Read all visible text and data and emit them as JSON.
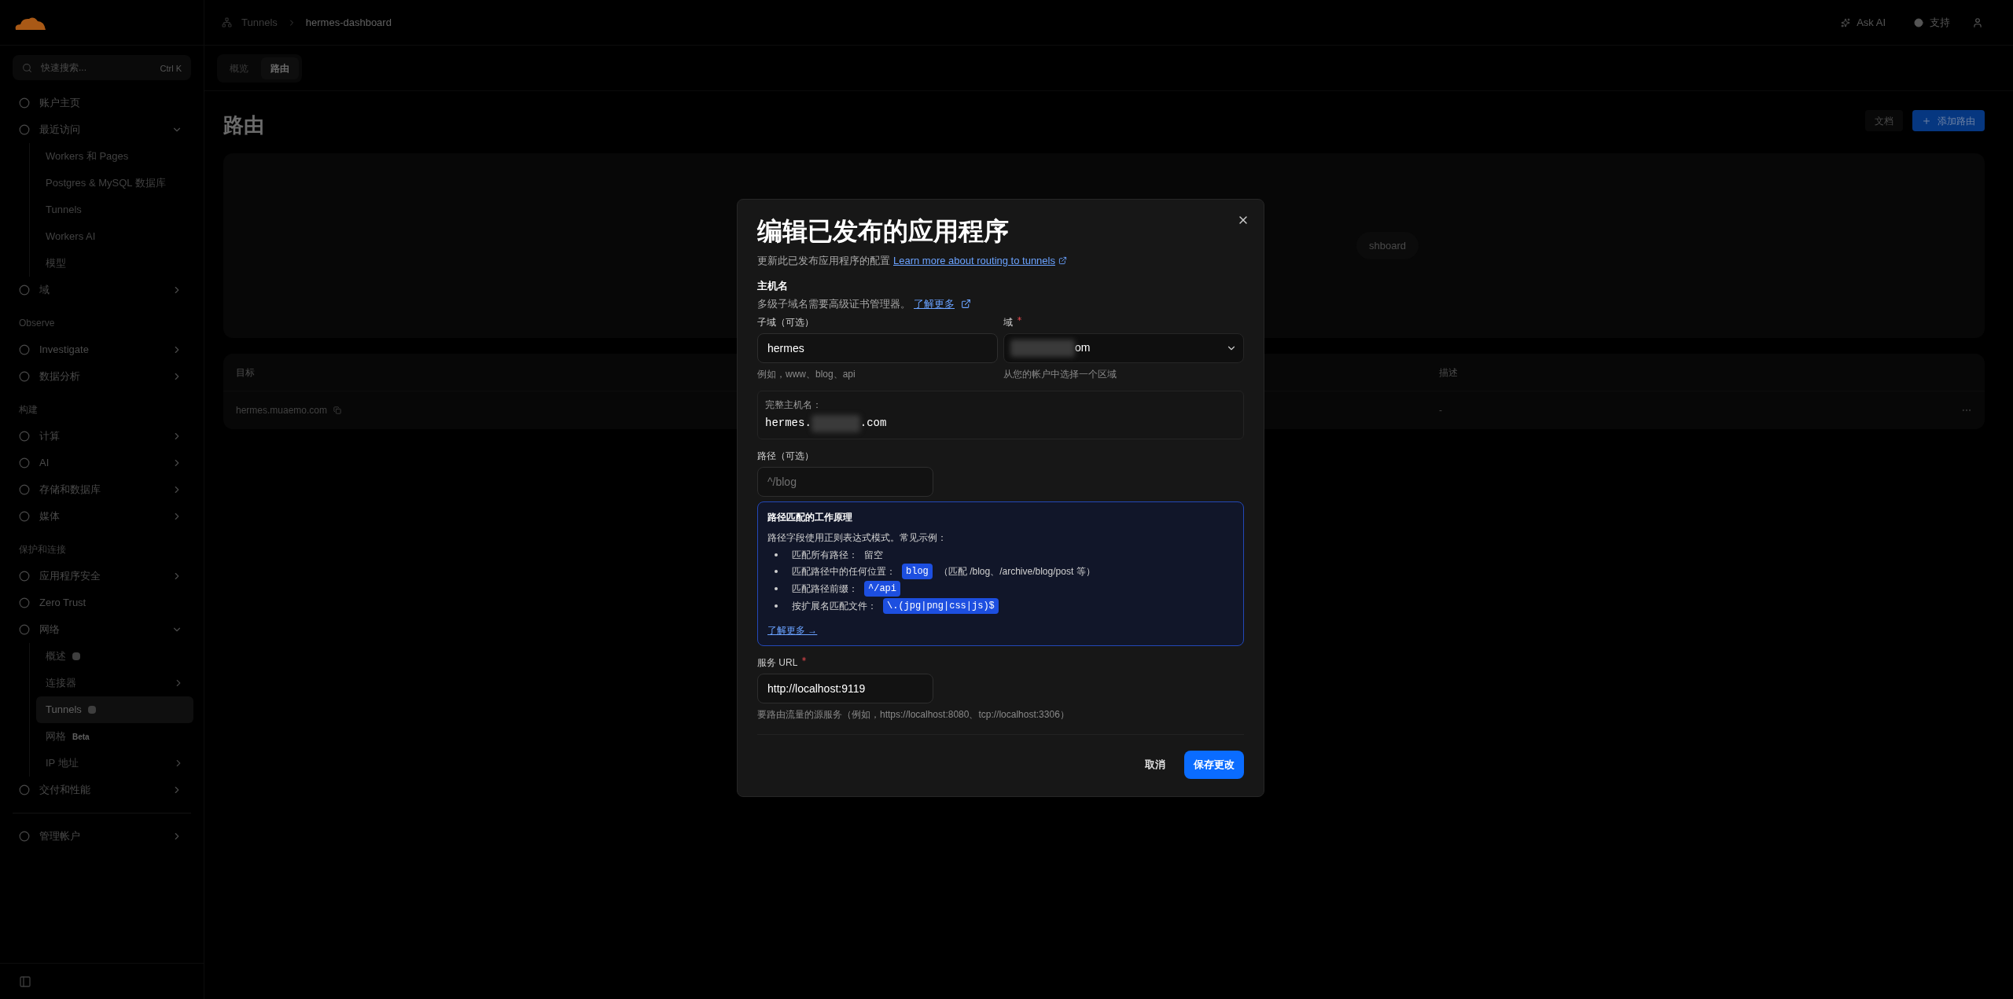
{
  "sidebar": {
    "search": {
      "placeholder": "快速搜索...",
      "shortcut": "Ctrl K"
    },
    "items": [
      {
        "kind": "item",
        "label": "账户主页"
      },
      {
        "kind": "group",
        "label": "最近访问",
        "expanded": true,
        "children": [
          {
            "label": "Workers 和 Pages",
            "selected": false
          },
          {
            "label": "Postgres & MySQL 数据库",
            "selected": false
          },
          {
            "label": "Tunnels",
            "selected": false
          },
          {
            "label": "Workers AI",
            "selected": false
          },
          {
            "label": "模型",
            "selected": false
          }
        ]
      },
      {
        "kind": "group",
        "label": "域",
        "expanded": false
      },
      {
        "kind": "section",
        "label": "Observe"
      },
      {
        "kind": "group",
        "label": "Investigate",
        "expanded": false
      },
      {
        "kind": "group",
        "label": "数据分析",
        "expanded": false
      },
      {
        "kind": "section",
        "label": "构建"
      },
      {
        "kind": "group",
        "label": "计算",
        "expanded": false
      },
      {
        "kind": "group",
        "label": "AI",
        "expanded": false
      },
      {
        "kind": "group",
        "label": "存储和数据库",
        "expanded": false
      },
      {
        "kind": "group",
        "label": "媒体",
        "expanded": false
      },
      {
        "kind": "section",
        "label": "保护和连接"
      },
      {
        "kind": "group",
        "label": "应用程序安全",
        "expanded": false
      },
      {
        "kind": "item",
        "label": "Zero Trust"
      },
      {
        "kind": "group",
        "label": "网络",
        "expanded": true,
        "children": [
          {
            "label": "概述",
            "selected": false,
            "icon_badge": true
          },
          {
            "label": "连接器",
            "selected": false,
            "chevron": true
          },
          {
            "label": "Tunnels",
            "selected": true,
            "icon_badge": true
          },
          {
            "label": "网格",
            "selected": false,
            "badge": "Beta"
          },
          {
            "label": "IP 地址",
            "selected": false,
            "chevron": true
          }
        ]
      },
      {
        "kind": "group",
        "label": "交付和性能",
        "expanded": false
      },
      {
        "kind": "divider"
      },
      {
        "kind": "group",
        "label": "管理帐户",
        "expanded": false
      }
    ]
  },
  "header": {
    "breadcrumb": [
      "Tunnels",
      "hermes-dashboard"
    ],
    "ask_ai": "Ask AI",
    "support": "支持"
  },
  "tabs": [
    {
      "label": "概览",
      "selected": false
    },
    {
      "label": "路由",
      "selected": true
    }
  ],
  "page": {
    "title": "路由",
    "buttons": [
      {
        "label": "文档",
        "kind": "secondary"
      },
      {
        "label": "添加路由",
        "kind": "primary"
      }
    ],
    "diagram_node": "shboard",
    "table": {
      "columns": [
        "目标",
        "描述"
      ],
      "rows": [
        [
          "hermes.muaemo.com",
          "-"
        ]
      ]
    }
  },
  "dialog": {
    "title": "编辑已发布的应用程序",
    "subtitle": "更新此已发布应用程序的配置",
    "subtitle_link": "Learn more about routing to tunnels",
    "hostname": {
      "heading": "主机名",
      "note": "多级子域名需要高级证书管理器。",
      "note_link": "了解更多",
      "subdomain": {
        "label": "子域（可选）",
        "value": "hermes",
        "hint": "例如，www、blog、api"
      },
      "domain": {
        "label": "域",
        "required": true,
        "value": "om",
        "hint": "从您的帐户中选择一个区域"
      },
      "full": {
        "label": "完整主机名：",
        "prefix": "hermes.",
        "suffix": ".com"
      }
    },
    "path": {
      "label": "路径（可选）",
      "placeholder": "^/blog"
    },
    "info": {
      "title": "路径匹配的工作原理",
      "intro": "路径字段使用正则表达式模式。常见示例：",
      "items": [
        {
          "text": "匹配所有路径：",
          "after": "留空"
        },
        {
          "text": "匹配路径中的任何位置：",
          "code": "blog",
          "after": "（匹配 /blog、/archive/blog/post 等）"
        },
        {
          "text": "匹配路径前缀：",
          "code": "^/api"
        },
        {
          "text": "按扩展名匹配文件：",
          "code": "\\.(jpg|png|css|js)$"
        }
      ],
      "link": "了解更多 →"
    },
    "service": {
      "label": "服务 URL",
      "required": true,
      "value": "http://localhost:9119",
      "hint": "要路由流量的源服务（例如，https://localhost:8080、tcp://localhost:3306）"
    },
    "buttons": [
      {
        "label": "取消",
        "kind": "secondary"
      },
      {
        "label": "保存更改",
        "kind": "primary"
      }
    ]
  }
}
